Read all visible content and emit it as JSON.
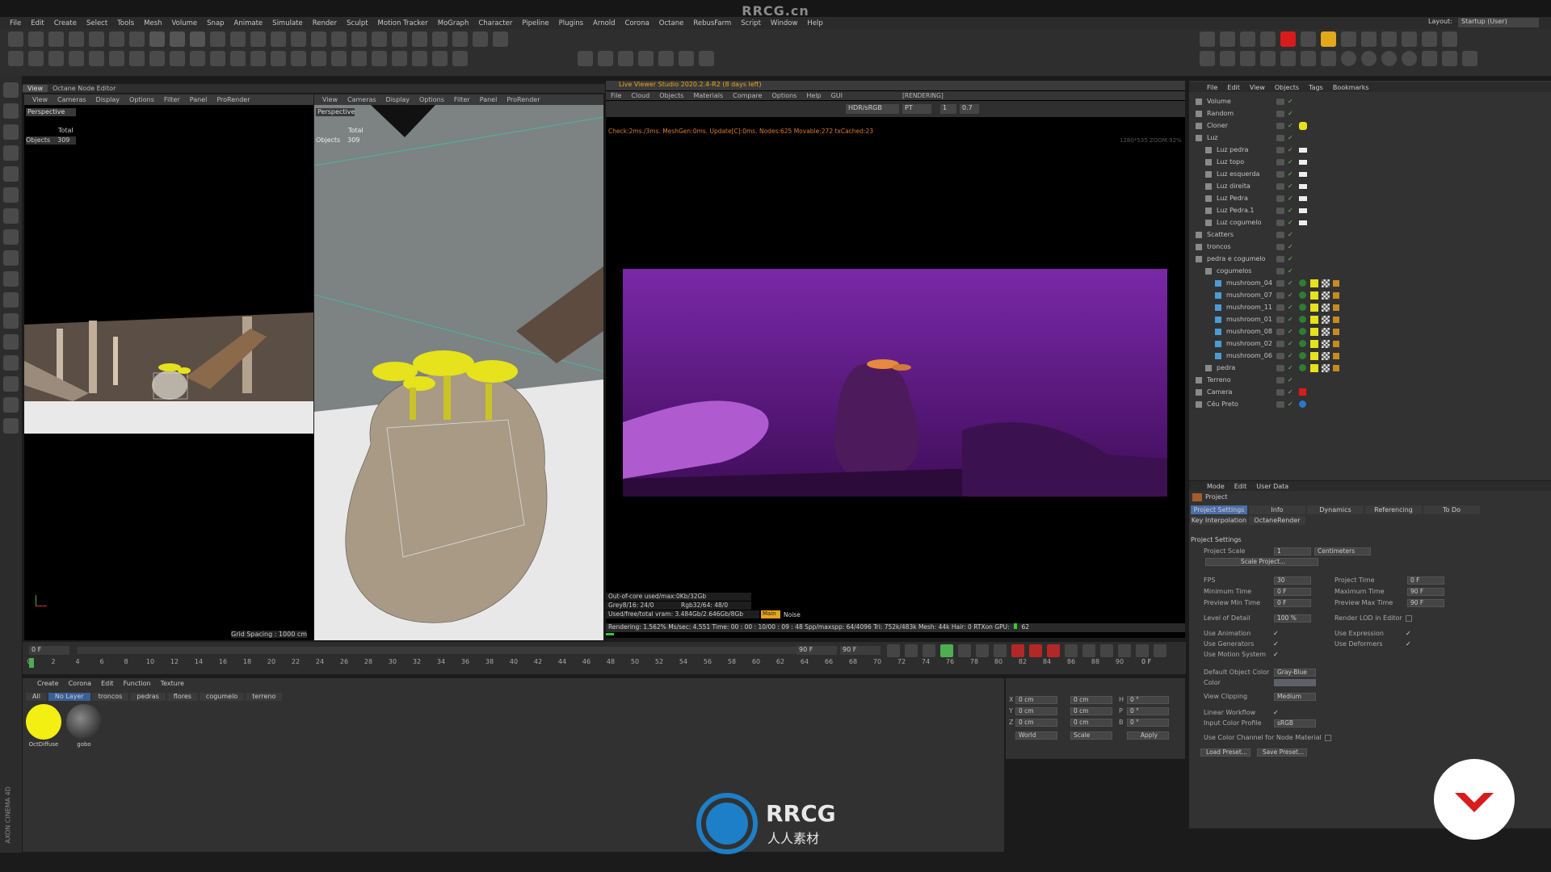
{
  "watermark": {
    "top": "RRCG.cn",
    "logo_text": "RRCG",
    "logo_sub": "人人素材"
  },
  "menu": [
    "File",
    "Edit",
    "Create",
    "Select",
    "Tools",
    "Mesh",
    "Volume",
    "Snap",
    "Animate",
    "Simulate",
    "Render",
    "Sculpt",
    "Motion Tracker",
    "MoGraph",
    "Character",
    "Pipeline",
    "Plugins",
    "Arnold",
    "Corona",
    "Octane",
    "RebusFarm",
    "Script",
    "Window",
    "Help"
  ],
  "layout": {
    "label": "Layout:",
    "value": "Startup (User)"
  },
  "viewport_tabs": {
    "view": "View",
    "octane_editor": "Octane Node Editor"
  },
  "viewport_menu": [
    "View",
    "Cameras",
    "Display",
    "Options",
    "Filter",
    "Panel",
    "ProRender"
  ],
  "viewport_left": {
    "title": "Perspective",
    "total_label": "Total",
    "objects_label": "Objects",
    "objects_value": "309",
    "grid": "Grid Spacing : 1000 cm"
  },
  "viewport_mid": {
    "title": "Perspective",
    "total_label": "Total",
    "objects_label": "Objects",
    "objects_value": "309"
  },
  "live_viewer": {
    "title": "Live Viewer Studio 2020.2.4-R2 (8 days left)",
    "menu": [
      "File",
      "Cloud",
      "Objects",
      "Materials",
      "Compare",
      "Options",
      "Help",
      "GUI"
    ],
    "status_rendering": "[RENDERING]",
    "hdr": "HDR/sRGB",
    "pt": "PT",
    "num1": "1",
    "num2": "0.7",
    "check": "Check:2ms./3ms. MeshGen:0ms. Update[C]:0ms. Nodes:625 Movable:272 txCached:23",
    "size_info": "1280*535 ZOOM:92%",
    "outofcore": "Out-of-core used/max:0Kb/32Gb",
    "grey": "Grey8/16: 24/0",
    "rgb": "Rgb32/64: 48/0",
    "vram": "Used/free/total vram: 3.484Gb/2.646Gb/8Gb",
    "noise_tag": "Main",
    "noise": "Noise",
    "stats": "Rendering: 1.562%    Ms/sec: 4.551   Time: 00 : 00 : 10/00 : 09 : 48   Spp/maxspp: 64/4096   Tri: 752k/483k  Mesh: 44k  Hair: 0   RTXon    GPU:",
    "gpu_val": "62"
  },
  "objects_panel": {
    "menu": [
      "File",
      "Edit",
      "View",
      "Objects",
      "Tags",
      "Bookmarks"
    ],
    "items": [
      {
        "name": "Volume",
        "indent": 0
      },
      {
        "name": "Random",
        "indent": 0
      },
      {
        "name": "Cloner",
        "indent": 0
      },
      {
        "name": "Luz",
        "indent": 0
      },
      {
        "name": "Luz pedra",
        "indent": 1
      },
      {
        "name": "Luz topo",
        "indent": 1
      },
      {
        "name": "Luz esquerda",
        "indent": 1
      },
      {
        "name": "Luz direita",
        "indent": 1
      },
      {
        "name": "Luz Pedra",
        "indent": 1
      },
      {
        "name": "Luz Pedra.1",
        "indent": 1
      },
      {
        "name": "Luz cogumelo",
        "indent": 1
      },
      {
        "name": "Scatters",
        "indent": 0
      },
      {
        "name": "troncos",
        "indent": 0
      },
      {
        "name": "pedra e cogumelo",
        "indent": 0
      },
      {
        "name": "cogumelos",
        "indent": 1
      },
      {
        "name": "mushroom_04",
        "indent": 2
      },
      {
        "name": "mushroom_07",
        "indent": 2
      },
      {
        "name": "mushroom_11",
        "indent": 2
      },
      {
        "name": "mushroom_01",
        "indent": 2
      },
      {
        "name": "mushroom_08",
        "indent": 2
      },
      {
        "name": "mushroom_02",
        "indent": 2
      },
      {
        "name": "mushroom_06",
        "indent": 2
      },
      {
        "name": "pedra",
        "indent": 1
      },
      {
        "name": "Terreno",
        "indent": 0
      },
      {
        "name": "Camera",
        "indent": 0
      },
      {
        "name": "Céu Preto",
        "indent": 0
      }
    ]
  },
  "attributes": {
    "menu": [
      "Mode",
      "Edit",
      "User Data"
    ],
    "title": "Project",
    "tabs": [
      "Project Settings",
      "Info",
      "Dynamics",
      "Referencing",
      "To Do"
    ],
    "tabs2": [
      "Key Interpolation",
      "OctaneRender"
    ],
    "section": "Project Settings",
    "project_scale_label": "Project Scale",
    "project_scale_value": "1",
    "project_scale_unit": "Centimeters",
    "scale_project_btn": "Scale Project...",
    "fps_label": "FPS",
    "fps_value": "30",
    "project_time_label": "Project Time",
    "project_time_value": "0 F",
    "min_time_label": "Minimum Time",
    "min_time_value": "0 F",
    "max_time_label": "Maximum Time",
    "max_time_value": "90 F",
    "prev_min_label": "Preview Min Time",
    "prev_min_value": "0 F",
    "prev_max_label": "Preview Max Time",
    "prev_max_value": "90 F",
    "lod_label": "Level of Detail",
    "lod_value": "100 %",
    "render_lod_label": "Render LOD in Editor",
    "use_anim_label": "Use Animation",
    "use_expr_label": "Use Expression",
    "use_gen_label": "Use Generators",
    "use_def_label": "Use Deformers",
    "use_motion_label": "Use Motion System",
    "default_color_label": "Default Object Color",
    "default_color_value": "Gray-Blue",
    "color_label": "Color",
    "view_clip_label": "View Clipping",
    "view_clip_value": "Medium",
    "linear_label": "Linear Workflow",
    "input_profile_label": "Input Color Profile",
    "input_profile_value": "sRGB",
    "color_channel_label": "Use Color Channel for Node Material",
    "load_preset": "Load Preset...",
    "save_preset": "Save Preset..."
  },
  "timeline": {
    "start_field": "0 F",
    "end_field": "90 F",
    "end_field2": "90 F",
    "current": "0 F",
    "ticks": [
      "0",
      "2",
      "4",
      "6",
      "8",
      "10",
      "12",
      "14",
      "16",
      "18",
      "20",
      "22",
      "24",
      "26",
      "28",
      "30",
      "32",
      "34",
      "36",
      "38",
      "40",
      "42",
      "44",
      "46",
      "48",
      "50",
      "52",
      "54",
      "56",
      "58",
      "60",
      "62",
      "64",
      "66",
      "68",
      "70",
      "72",
      "74",
      "76",
      "78",
      "80",
      "82",
      "84",
      "86",
      "88",
      "90"
    ]
  },
  "material_manager": {
    "menu": [
      "Create",
      "Corona",
      "Edit",
      "Function",
      "Texture"
    ],
    "layers": [
      "All",
      "No Layer",
      "troncos",
      "pedras",
      "flores",
      "cogumelo",
      "terreno"
    ],
    "materials": [
      {
        "name": "OctDiffuse"
      },
      {
        "name": "gobo"
      }
    ]
  },
  "coords": {
    "x_label": "X",
    "y_label": "Y",
    "z_label": "Z",
    "px": "0 cm",
    "py": "0 cm",
    "pz": "0 cm",
    "sx": "0 cm",
    "sy": "0 cm",
    "sz": "0 cm",
    "h_label": "H",
    "p_label": "P",
    "b_label": "B",
    "h": "0 °",
    "p": "0 °",
    "b": "0 °",
    "world": "World",
    "scale": "Scale",
    "apply": "Apply"
  },
  "brand": {
    "side": "AXON CINEMA 4D"
  },
  "colors": {
    "accent_orange": "#e7a41b",
    "render_purple": "#7a1fa0",
    "mushroom_yellow": "#e6e21b",
    "record_red": "#d81c1c"
  }
}
